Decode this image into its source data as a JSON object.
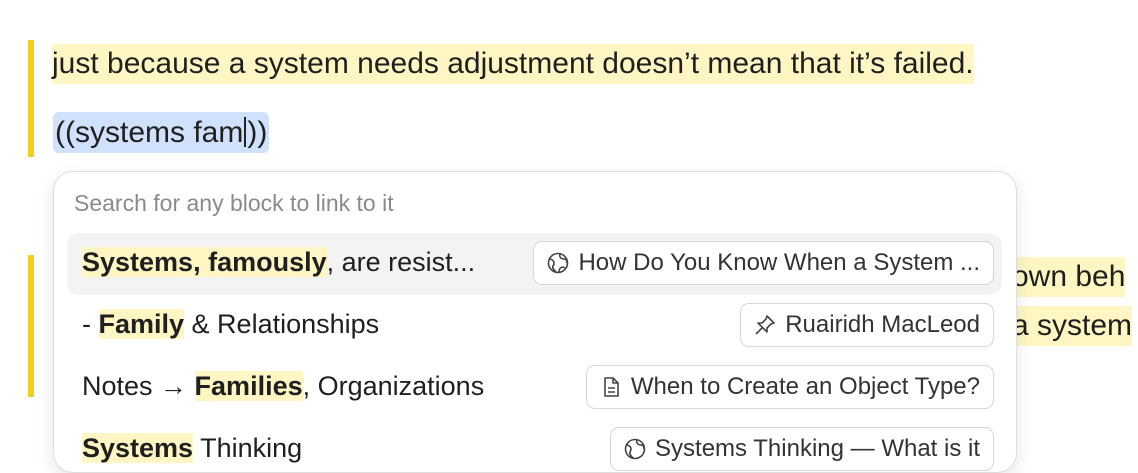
{
  "editor": {
    "quote_line": "just because a system needs adjustment doesn’t mean that it’s failed.",
    "ref_open": "((",
    "ref_query_before_caret": "systems fam",
    "ref_close": "))",
    "behind_line_1": "own beh",
    "behind_line_2": "a system"
  },
  "popup": {
    "search_placeholder": "Search for any block to link to it",
    "results": [
      {
        "prefix": "",
        "match": "Systems, famously",
        "suffix": ", are resist...",
        "source": "How Do You Know When a System ...",
        "source_icon": "globe-icon",
        "active": true
      },
      {
        "prefix": "- ",
        "match": "Family",
        "suffix": " & Relationships",
        "source": "Ruairidh MacLeod",
        "source_icon": "pushpin-icon",
        "active": false
      },
      {
        "prefix": "Notes → ",
        "match": "Families",
        "suffix": ", Organizations",
        "source": "When to Create an Object Type?",
        "source_icon": "document-icon",
        "active": false
      },
      {
        "prefix": "",
        "match": "Systems",
        "suffix": " Thinking",
        "source": "Systems Thinking — What is it",
        "source_icon": "globe-icon",
        "active": false
      }
    ]
  },
  "colors": {
    "highlight": "#fff6c4",
    "quote_bar": "#f5cd1c",
    "ref_selection": "#cfe1fb"
  }
}
